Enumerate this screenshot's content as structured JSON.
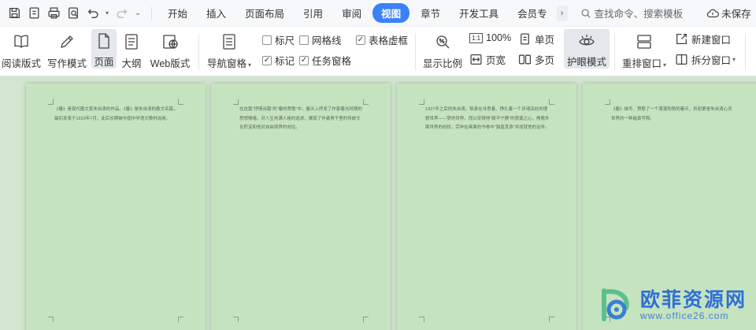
{
  "menubar": {
    "tabs": [
      {
        "label": "开始",
        "active": false
      },
      {
        "label": "插入",
        "active": false
      },
      {
        "label": "页面布局",
        "active": false
      },
      {
        "label": "引用",
        "active": false
      },
      {
        "label": "审阅",
        "active": false
      },
      {
        "label": "视图",
        "active": true
      },
      {
        "label": "章节",
        "active": false
      },
      {
        "label": "开发工具",
        "active": false
      },
      {
        "label": "会员专",
        "active": false
      }
    ],
    "more_arrow": "›",
    "search_placeholder": "查找命令、搜索模板",
    "unsaved_label": "未保存"
  },
  "ribbon": {
    "read_mode": "阅读版式",
    "write_mode": "写作模式",
    "page": "页面",
    "outline": "大纲",
    "web_layout": "Web版式",
    "nav_pane": "导航窗格",
    "ruler": "标尺",
    "gridlines": "网格线",
    "table_gridlines": "表格虚框",
    "marks": "标记",
    "task_pane": "任务窗格",
    "zoom_ratio": "显示比例",
    "one_to_one": "1:1",
    "percent_100": "100%",
    "single_page": "单页",
    "page_width": "页宽",
    "multi_page": "多页",
    "eye_care": "护眼模式",
    "rearrange": "重排窗口",
    "new_window": "新建窗口",
    "split_window": "拆分窗口",
    "checks": {
      "ruler": false,
      "gridlines": false,
      "table_gridlines": true,
      "marks": true,
      "task_pane": true
    }
  },
  "pages": [
    {
      "text": "《春》是现代散文家朱自清的作品。《春》是朱自清的散文名篇，最初发表于1933年7月，此后长期被中国中学语文教材选用。"
    },
    {
      "text": "在这篇“抒情诗篇”的“春的赞歌”中，春天上抒发了作家春光时期的思想情绪，对人生充满人格的追求，展现了作者骨子里的传统文化积淀和他对自由境界的向往。"
    },
    {
      "text": "1927年之后的朱自清，陷身在寻思着、挣扎着一个灵魂深处的理想世界——梦的世界。而以安顿他“颇不宁静”的寂寞之心，挣脱外面世界的纷扰，完毕在画面的书卷中“独善其身”并成就他的治学。"
    },
    {
      "text": "《春》描写、赞歌了一个蓬蓬勃勃的春天，折射更是朱自清心灵世界的一种遍真写照。"
    }
  ],
  "watermark": {
    "cn": "欧菲资源网",
    "url": "www.office26.com"
  },
  "colors": {
    "accent": "#3b82f6",
    "page_bg": "#c6e3c0",
    "area_bg": "#d3e6d0"
  }
}
